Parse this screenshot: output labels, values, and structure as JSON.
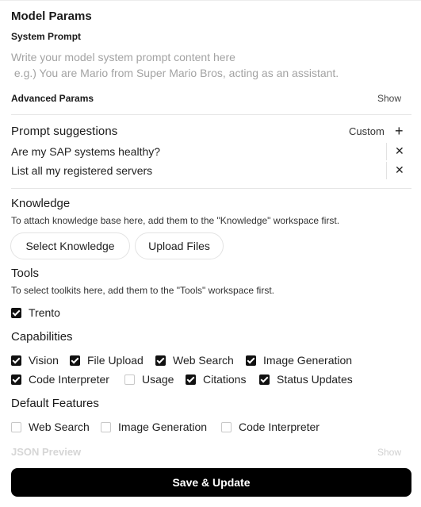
{
  "model_params": {
    "title": "Model Params",
    "system_prompt_label": "System Prompt",
    "system_prompt_placeholder": "Write your model system prompt content here\n e.g.) You are Mario from Super Mario Bros, acting as an assistant.",
    "system_prompt_value": "",
    "advanced_label": "Advanced Params",
    "advanced_show": "Show"
  },
  "prompt_suggestions": {
    "title": "Prompt suggestions",
    "custom_label": "Custom",
    "add_icon": "plus-icon",
    "items": [
      {
        "value": "Are my SAP systems healthy?"
      },
      {
        "value": "List all my registered servers"
      }
    ]
  },
  "knowledge": {
    "title": "Knowledge",
    "description": "To attach knowledge base here, add them to the \"Knowledge\" workspace first.",
    "select_button": "Select Knowledge",
    "upload_button": "Upload Files"
  },
  "tools": {
    "title": "Tools",
    "description": "To select toolkits here, add them to the \"Tools\" workspace first.",
    "items": [
      {
        "label": "Trento",
        "checked": true
      }
    ]
  },
  "capabilities": {
    "title": "Capabilities",
    "items": [
      {
        "label": "Vision",
        "checked": true
      },
      {
        "label": "File Upload",
        "checked": true
      },
      {
        "label": "Web Search",
        "checked": true
      },
      {
        "label": "Image Generation",
        "checked": true
      },
      {
        "label": "Code Interpreter",
        "checked": true
      },
      {
        "label": "Usage",
        "checked": false
      },
      {
        "label": "Citations",
        "checked": true
      },
      {
        "label": "Status Updates",
        "checked": true
      }
    ]
  },
  "default_features": {
    "title": "Default Features",
    "items": [
      {
        "label": "Web Search",
        "checked": false
      },
      {
        "label": "Image Generation",
        "checked": false
      },
      {
        "label": "Code Interpreter",
        "checked": false
      }
    ]
  },
  "json_preview": {
    "label": "JSON Preview",
    "show": "Show"
  },
  "save_button": "Save & Update",
  "colors": {
    "primary_button": "#000000",
    "checkbox_on": "#111111",
    "muted_text": "#a3a3a3",
    "divider": "#e6e6e6"
  }
}
